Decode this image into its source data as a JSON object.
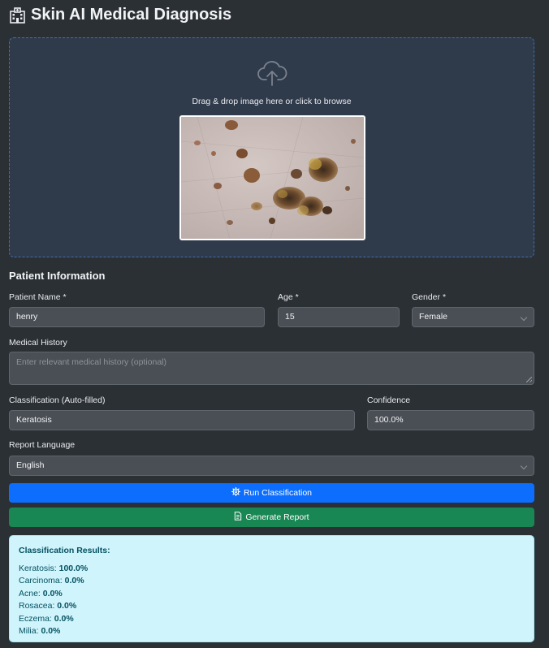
{
  "app": {
    "title": "Skin AI Medical Diagnosis",
    "title_icon": "hospital-icon"
  },
  "upload": {
    "icon": "cloud-upload-icon",
    "prompt": "Drag & drop image here or click to browse"
  },
  "patient": {
    "section_title": "Patient Information",
    "name_label": "Patient Name *",
    "name_value": "henry",
    "age_label": "Age *",
    "age_value": "15",
    "gender_label": "Gender *",
    "gender_value": "Female",
    "history_label": "Medical History",
    "history_placeholder": "Enter relevant medical history (optional)",
    "classification_label": "Classification (Auto-filled)",
    "classification_value": "Keratosis",
    "confidence_label": "Confidence",
    "confidence_value": "100.0%",
    "language_label": "Report Language",
    "language_value": "English"
  },
  "actions": {
    "run_label": "Run Classification",
    "run_icon": "gear-icon",
    "report_label": "Generate Report",
    "report_icon": "document-icon"
  },
  "results": {
    "title": "Classification Results:",
    "items": [
      {
        "name": "Keratosis:",
        "value": "100.0%"
      },
      {
        "name": "Carcinoma:",
        "value": "0.0%"
      },
      {
        "name": "Acne:",
        "value": "0.0%"
      },
      {
        "name": "Rosacea:",
        "value": "0.0%"
      },
      {
        "name": "Eczema:",
        "value": "0.0%"
      },
      {
        "name": "Milia:",
        "value": "0.0%"
      }
    ]
  },
  "colors": {
    "background": "#2b3035",
    "dropzone": "#2f3a4b",
    "primary": "#0d6efd",
    "success": "#198754",
    "info_bg": "#cff4fc",
    "info_text": "#055160"
  }
}
